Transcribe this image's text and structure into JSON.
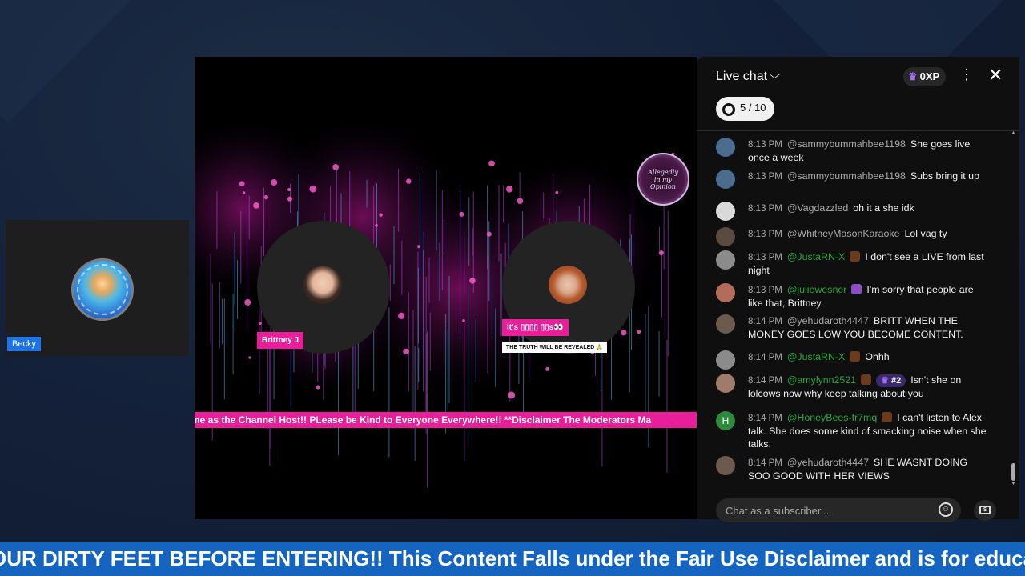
{
  "guest": {
    "name": "Becky"
  },
  "stage": {
    "speakers": [
      {
        "name": "Brittney J"
      },
      {
        "name": "It's ▯▯▯▯ ▯▯s👀",
        "subtitle": "THE TRUTH WILL BE REVEALED 🙏"
      }
    ],
    "ticker": "me as the Channel Host!! PLease be Kind to Everyone Everywhere!! **Disclaimer The Moderators Ma"
  },
  "chat": {
    "title": "Live chat",
    "xp": "0XP",
    "progress": "5 / 10",
    "placeholder": "Chat as a subscriber...",
    "messages": [
      {
        "time": "8:13 PM",
        "author": "@sammybummahbee1198",
        "text": "She goes live once a week",
        "avatar_color": "#4a6d8f",
        "mod": false
      },
      {
        "time": "8:13 PM",
        "author": "@sammybummahbee1198",
        "text": "Subs bring it up",
        "avatar_color": "#4a6d8f",
        "mod": false
      },
      {
        "time": "8:13 PM",
        "author": "@Vagdazzled",
        "text": "oh it a she idk",
        "avatar_color": "#d9d9d9",
        "mod": false
      },
      {
        "time": "8:13 PM",
        "author": "@WhitneyMasonKaraoke",
        "text": "Lol vag ty",
        "avatar_color": "#5b4a3f",
        "mod": false
      },
      {
        "time": "8:13 PM",
        "author": "@JustaRN-X",
        "text": "I don't see a LIVE from last night",
        "avatar_color": "#8b8b8b",
        "mod": true
      },
      {
        "time": "8:13 PM",
        "author": "@juliewesner",
        "text": "I'm sorry that people are like that, Brittney.",
        "avatar_color": "#b36b5a",
        "mod": true
      },
      {
        "time": "8:14 PM",
        "author": "@yehudaroth4447",
        "text": "BRITT WHEN THE MONEY GOES LOW YOU BECOME CONTENT.",
        "avatar_color": "#6d5a4f",
        "mod": false
      },
      {
        "time": "8:14 PM",
        "author": "@JustaRN-X",
        "text": "Ohhh",
        "avatar_color": "#8b8b8b",
        "mod": true
      },
      {
        "time": "8:14 PM",
        "author": "@amylynn2521",
        "rank": "#2",
        "text": "Isn't she on lolcows now why keep talking about you",
        "avatar_color": "#a07a6a",
        "mod": true
      },
      {
        "time": "8:14 PM",
        "author": "@HoneyBees-fr7mq",
        "text": "I can't listen to Alex talk. She does some kind of smacking noise when she talks.",
        "avatar_color": "#2e8b3d",
        "avatar_letter": "H",
        "mod": true
      },
      {
        "time": "8:14 PM",
        "author": "@yehudaroth4447",
        "text": "SHE WASNT DOING SOO GOOD WITH HER VIEWS",
        "avatar_color": "#6d5a4f",
        "mod": false
      }
    ]
  },
  "bottom_ticker": "OUR DIRTY FEET BEFORE ENTERING!! This Content Falls under the Fair Use Disclaimer and is for educationa"
}
